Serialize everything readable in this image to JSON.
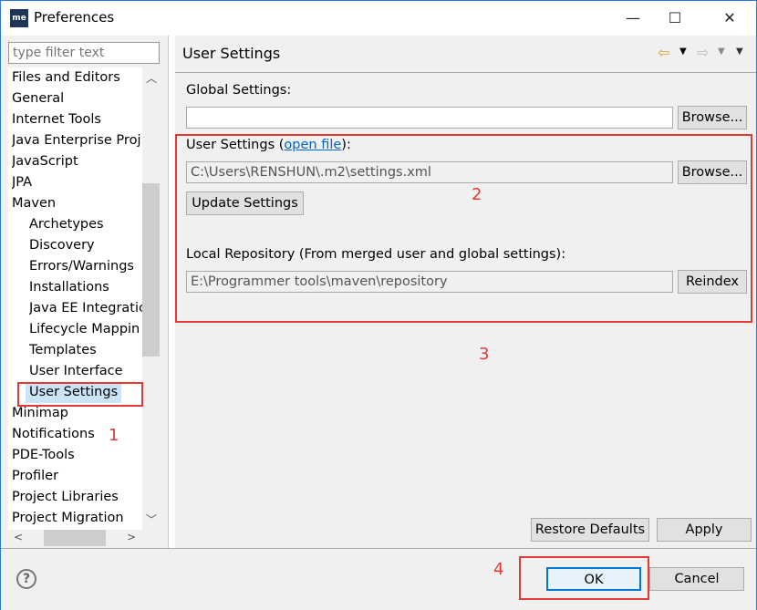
{
  "window": {
    "title": "Preferences",
    "logo": "me",
    "minimize": "—",
    "maximize": "☐",
    "close": "✕"
  },
  "sidebar": {
    "filter_placeholder": "type filter text",
    "items": [
      {
        "label": "Files and Editors",
        "child": false
      },
      {
        "label": "General",
        "child": false
      },
      {
        "label": "Internet Tools",
        "child": false
      },
      {
        "label": "Java Enterprise Proj",
        "child": false
      },
      {
        "label": "JavaScript",
        "child": false
      },
      {
        "label": "JPA",
        "child": false
      },
      {
        "label": "Maven",
        "child": false
      },
      {
        "label": "Archetypes",
        "child": true
      },
      {
        "label": "Discovery",
        "child": true
      },
      {
        "label": "Errors/Warnings",
        "child": true
      },
      {
        "label": "Installations",
        "child": true
      },
      {
        "label": "Java EE Integratic",
        "child": true
      },
      {
        "label": "Lifecycle Mappin",
        "child": true
      },
      {
        "label": "Templates",
        "child": true
      },
      {
        "label": "User Interface",
        "child": true
      },
      {
        "label": "User Settings",
        "child": true,
        "selected": true
      },
      {
        "label": "Minimap",
        "child": false
      },
      {
        "label": "Notifications",
        "child": false
      },
      {
        "label": "PDE-Tools",
        "child": false
      },
      {
        "label": "Profiler",
        "child": false
      },
      {
        "label": "Project Libraries",
        "child": false
      },
      {
        "label": "Project Migration",
        "child": false
      }
    ]
  },
  "page": {
    "title": "User Settings",
    "global_label": "Global Settings:",
    "global_value": "",
    "browse": "Browse...",
    "user_label": "User Settings (",
    "open_file": "open file",
    "user_label_end": "):",
    "user_value": "C:\\Users\\RENSHUN\\.m2\\settings.xml",
    "update": "Update Settings",
    "local_label": "Local Repository (From merged user and global settings):",
    "local_value": "E:\\Programmer tools\\maven\\repository",
    "reindex": "Reindex",
    "restore": "Restore Defaults",
    "apply": "Apply"
  },
  "footer": {
    "help": "?",
    "ok": "OK",
    "cancel": "Cancel"
  },
  "annotations": [
    "1",
    "2",
    "3",
    "4"
  ],
  "colors": {
    "annotation": "#e53935",
    "link": "#0066cc",
    "selection": "#cce4f7"
  }
}
